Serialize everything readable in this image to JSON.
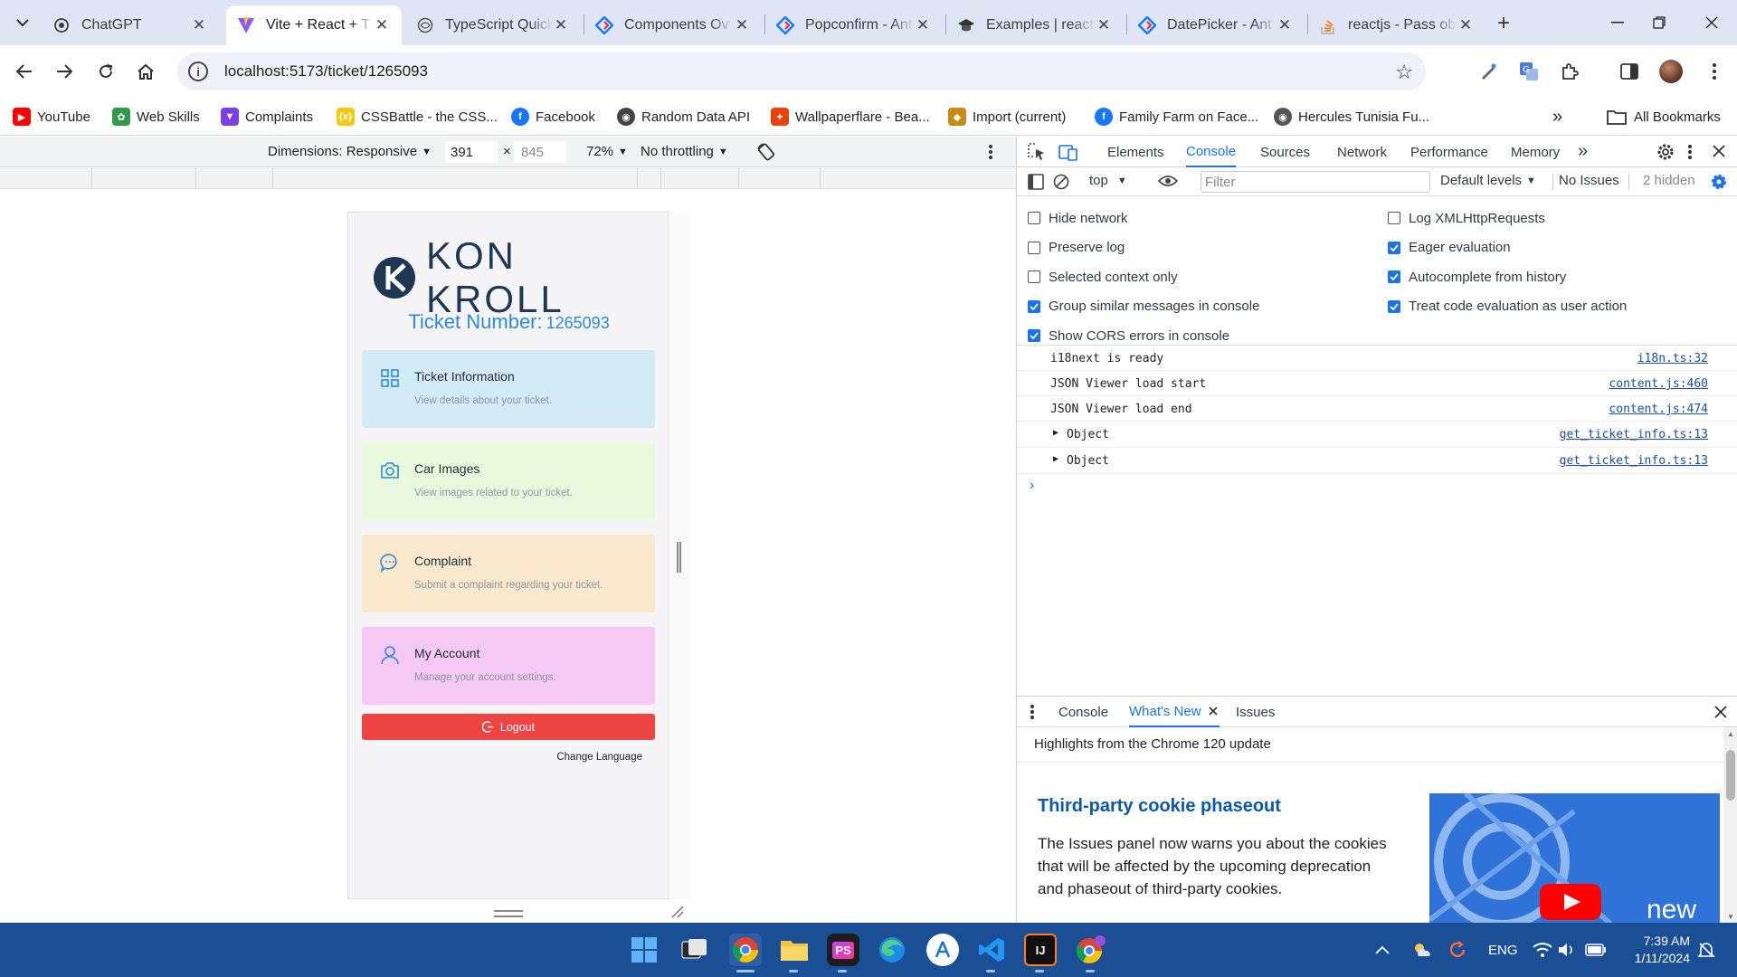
{
  "tabs": [
    {
      "title": "ChatGPT",
      "icon": "chatgpt-icon"
    },
    {
      "title": "Vite + React + TS",
      "icon": "vite-icon",
      "active": true
    },
    {
      "title": "TypeScript Quick",
      "icon": "typescript-icon"
    },
    {
      "title": "Components Ov",
      "icon": "antd-icon"
    },
    {
      "title": "Popconfirm - Ant",
      "icon": "antd-icon"
    },
    {
      "title": "Examples | react",
      "icon": "graduation-cap-icon"
    },
    {
      "title": "DatePicker - Ant",
      "icon": "antd-icon"
    },
    {
      "title": "reactjs - Pass obj",
      "icon": "stackoverflow-icon"
    }
  ],
  "address": {
    "url": "localhost:5173/ticket/1265093"
  },
  "bookmarks": [
    {
      "label": "YouTube",
      "color": "#ff0000"
    },
    {
      "label": "Web Skills",
      "color": "#2e9b4a"
    },
    {
      "label": "Complaints",
      "color": "#7b3fe4"
    },
    {
      "label": "CSSBattle - the CSS...",
      "color": "#f6c90e"
    },
    {
      "label": "Facebook",
      "color": "#1877f2"
    },
    {
      "label": "Random Data API",
      "color": "#444444"
    },
    {
      "label": "Wallpaperflare - Bea...",
      "color": "#e8420f"
    },
    {
      "label": "Import (current)",
      "color": "#c88a14"
    },
    {
      "label": "Family Farm on Face...",
      "color": "#1877f2"
    },
    {
      "label": "Hercules Tunisia Fu...",
      "color": "#555555"
    }
  ],
  "all_bookmarks": "All Bookmarks",
  "device_toolbar": {
    "dimensions": "Dimensions: Responsive",
    "width": "391",
    "height": "845",
    "zoom": "72%",
    "throttling": "No throttling"
  },
  "app": {
    "brand": "KON KROLL",
    "ticket_label": "Ticket Number:",
    "ticket_number": "1265093",
    "cards": [
      {
        "title": "Ticket Information",
        "desc": "View details about your ticket.",
        "bg": "#d3ebf6",
        "icon": "grid-icon"
      },
      {
        "title": "Car Images",
        "desc": "View images related to your ticket.",
        "bg": "#e8f9dd",
        "icon": "camera-icon"
      },
      {
        "title": "Complaint",
        "desc": "Submit a complaint regarding your ticket.",
        "bg": "#fbe9cd",
        "icon": "chat-icon"
      },
      {
        "title": "My Account",
        "desc": "Manage your account settings.",
        "bg": "#f6c9f5",
        "icon": "user-icon"
      }
    ],
    "logout": "Logout",
    "change_language": "Change Language",
    "accent": "#2e8ad8",
    "logout_color": "#ef4444"
  },
  "devtools": {
    "tabs": [
      "Elements",
      "Console",
      "Sources",
      "Network",
      "Performance",
      "Memory"
    ],
    "active_tab": "Console",
    "context": "top",
    "filter_placeholder": "Filter",
    "levels": "Default levels",
    "issues": "No Issues",
    "hidden": "2 hidden",
    "settings_left": [
      {
        "label": "Hide network",
        "checked": false
      },
      {
        "label": "Preserve log",
        "checked": false
      },
      {
        "label": "Selected context only",
        "checked": false
      },
      {
        "label": "Group similar messages in console",
        "checked": true
      },
      {
        "label": "Show CORS errors in console",
        "checked": true
      }
    ],
    "settings_right": [
      {
        "label": "Log XMLHttpRequests",
        "checked": false
      },
      {
        "label": "Eager evaluation",
        "checked": true
      },
      {
        "label": "Autocomplete from history",
        "checked": true
      },
      {
        "label": "Treat code evaluation as user action",
        "checked": true
      }
    ],
    "logs": [
      {
        "message": "i18next is ready",
        "source": "i18n.ts:32",
        "expandable": false
      },
      {
        "message": "JSON Viewer load start",
        "source": "content.js:460",
        "expandable": false
      },
      {
        "message": "JSON Viewer load end",
        "source": "content.js:474",
        "expandable": false
      },
      {
        "message": "Object",
        "source": "get_ticket_info.ts:13",
        "expandable": true
      },
      {
        "message": "Object",
        "source": "get_ticket_info.ts:13",
        "expandable": true
      }
    ],
    "drawer": {
      "tabs": [
        "Console",
        "What's New",
        "Issues"
      ],
      "active": "What's New",
      "subtitle": "Highlights from the Chrome 120 update",
      "heading": "Third-party cookie phaseout",
      "body": "The Issues panel now warns you about the cookies that will be affected by the upcoming deprecation and phaseout of third-party cookies.",
      "badge": "new"
    }
  },
  "taskbar": {
    "lang": "ENG",
    "time": "7:39 AM",
    "date": "1/11/2024"
  }
}
